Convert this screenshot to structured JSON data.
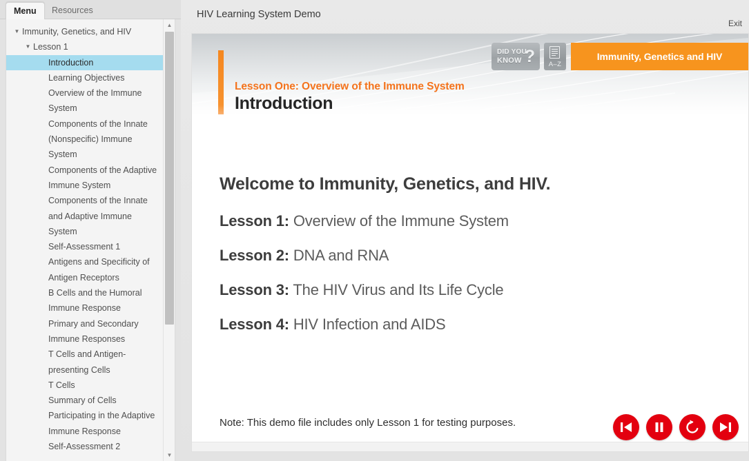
{
  "colors": {
    "accent_orange": "#f7941e",
    "eyebrow_orange": "#f4731c",
    "selection_blue": "#a5dcef",
    "control_red": "#e3000f",
    "panel_gray": "#e3e3e3"
  },
  "menu_panel": {
    "tabs": [
      {
        "label": "Menu",
        "active": true
      },
      {
        "label": "Resources",
        "active": false
      }
    ],
    "tree": [
      {
        "label": "Immunity, Genetics, and HIV",
        "level": 0,
        "caret": "▼",
        "selected": false
      },
      {
        "label": "Lesson 1",
        "level": 1,
        "caret": "▼",
        "selected": false
      },
      {
        "label": "Introduction",
        "level": 2,
        "caret": "",
        "selected": true
      },
      {
        "label": "Learning Objectives",
        "level": 2,
        "caret": "",
        "selected": false
      },
      {
        "label": "Overview of the Immune System",
        "level": 2,
        "caret": "",
        "selected": false
      },
      {
        "label": "Components of the Innate (Nonspecific) Immune System",
        "level": 2,
        "caret": "",
        "selected": false
      },
      {
        "label": "Components of the Adaptive Immune System",
        "level": 2,
        "caret": "",
        "selected": false
      },
      {
        "label": "Components of the Innate and Adaptive Immune System",
        "level": 2,
        "caret": "",
        "selected": false
      },
      {
        "label": "Self-Assessment 1",
        "level": 2,
        "caret": "",
        "selected": false
      },
      {
        "label": "Antigens and Specificity of Antigen Receptors",
        "level": 2,
        "caret": "",
        "selected": false
      },
      {
        "label": "B Cells and the Humoral Immune Response",
        "level": 2,
        "caret": "",
        "selected": false
      },
      {
        "label": "Primary and Secondary Immune Responses",
        "level": 2,
        "caret": "",
        "selected": false
      },
      {
        "label": "T Cells and Antigen-presenting Cells",
        "level": 2,
        "caret": "",
        "selected": false
      },
      {
        "label": "T Cells",
        "level": 2,
        "caret": "",
        "selected": false
      },
      {
        "label": "Summary of Cells Participating in the Adaptive Immune Response",
        "level": 2,
        "caret": "",
        "selected": false
      },
      {
        "label": "Self-Assessment 2",
        "level": 2,
        "caret": "",
        "selected": false
      }
    ],
    "scrollbar": {
      "up_arrow": "▲",
      "down_arrow": "▼"
    }
  },
  "stage": {
    "title": "HIV Learning System Demo",
    "exit_label": "Exit"
  },
  "slide": {
    "banner": {
      "eyebrow": "Lesson One: Overview of the Immune System",
      "heading": "Introduction",
      "did_you_know": {
        "line1": "DID YOU",
        "line2": "KNOW",
        "mark": "?"
      },
      "glossary": {
        "label": "A–Z"
      },
      "course_chip": "Immunity, Genetics and HIV"
    },
    "body": {
      "welcome": "Welcome to Immunity, Genetics, and HIV.",
      "lessons": [
        {
          "label": "Lesson 1:",
          "title": "Overview of the Immune System"
        },
        {
          "label": "Lesson 2:",
          "title": "DNA and RNA"
        },
        {
          "label": "Lesson 3:",
          "title": "The HIV Virus and Its Life Cycle"
        },
        {
          "label": "Lesson 4:",
          "title": "HIV Infection and AIDS"
        }
      ],
      "note": "Note: This demo file includes only Lesson 1 for testing purposes."
    },
    "controls": [
      {
        "name": "previous",
        "title": "Previous"
      },
      {
        "name": "pause",
        "title": "Pause"
      },
      {
        "name": "replay",
        "title": "Replay"
      },
      {
        "name": "next",
        "title": "Next"
      }
    ]
  }
}
